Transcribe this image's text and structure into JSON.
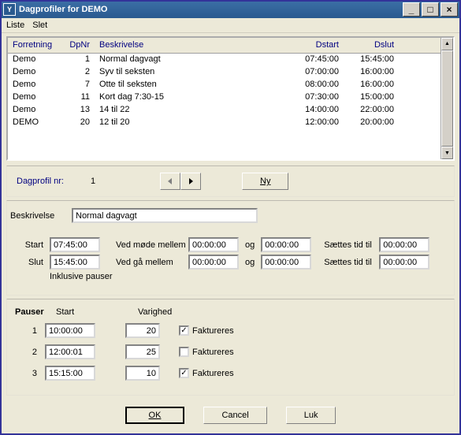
{
  "title": "Dagprofiler for DEMO",
  "menu": {
    "liste": "Liste",
    "slet": "Slet"
  },
  "grid": {
    "headers": {
      "forretning": "Forretning",
      "dpnr": "DpNr",
      "beskrivelse": "Beskrivelse",
      "dstart": "Dstart",
      "dslut": "Dslut"
    },
    "rows": [
      {
        "f": "Demo",
        "n": "1",
        "b": "Normal dagvagt",
        "s": "07:45:00",
        "e": "15:45:00"
      },
      {
        "f": "Demo",
        "n": "2",
        "b": "Syv til seksten",
        "s": "07:00:00",
        "e": "16:00:00"
      },
      {
        "f": "Demo",
        "n": "7",
        "b": "Otte til seksten",
        "s": "08:00:00",
        "e": "16:00:00"
      },
      {
        "f": "Demo",
        "n": "11",
        "b": "Kort dag 7:30-15",
        "s": "07:30:00",
        "e": "15:00:00"
      },
      {
        "f": "Demo",
        "n": "13",
        "b": "14 til 22",
        "s": "14:00:00",
        "e": "22:00:00"
      },
      {
        "f": "DEMO",
        "n": "20",
        "b": "12 til 20",
        "s": "12:00:00",
        "e": "20:00:00"
      }
    ]
  },
  "nav": {
    "label": "Dagprofil nr:",
    "value": "1",
    "ny": "Ny"
  },
  "detail": {
    "beskrivelse_label": "Beskrivelse",
    "beskrivelse": "Normal dagvagt",
    "start_label": "Start",
    "start": "07:45:00",
    "slut_label": "Slut",
    "slut": "15:45:00",
    "ved_mode": "Ved møde mellem",
    "ved_ga": "Ved gå mellem",
    "og": "og",
    "sattes": "Sættes tid til",
    "mm1": "00:00:00",
    "mm2": "00:00:00",
    "st1": "00:00:00",
    "gm1": "00:00:00",
    "gm2": "00:00:00",
    "st2": "00:00:00",
    "ink": "Inklusive pauser"
  },
  "pauser": {
    "title": "Pauser",
    "start": "Start",
    "varighed": "Varighed",
    "fak": "Faktureres",
    "rows": [
      {
        "n": "1",
        "s": "10:00:00",
        "d": "20",
        "c": true
      },
      {
        "n": "2",
        "s": "12:00:01",
        "d": "25",
        "c": false
      },
      {
        "n": "3",
        "s": "15:15:00",
        "d": "10",
        "c": true
      }
    ]
  },
  "buttons": {
    "ok": "OK",
    "cancel": "Cancel",
    "luk": "Luk"
  }
}
